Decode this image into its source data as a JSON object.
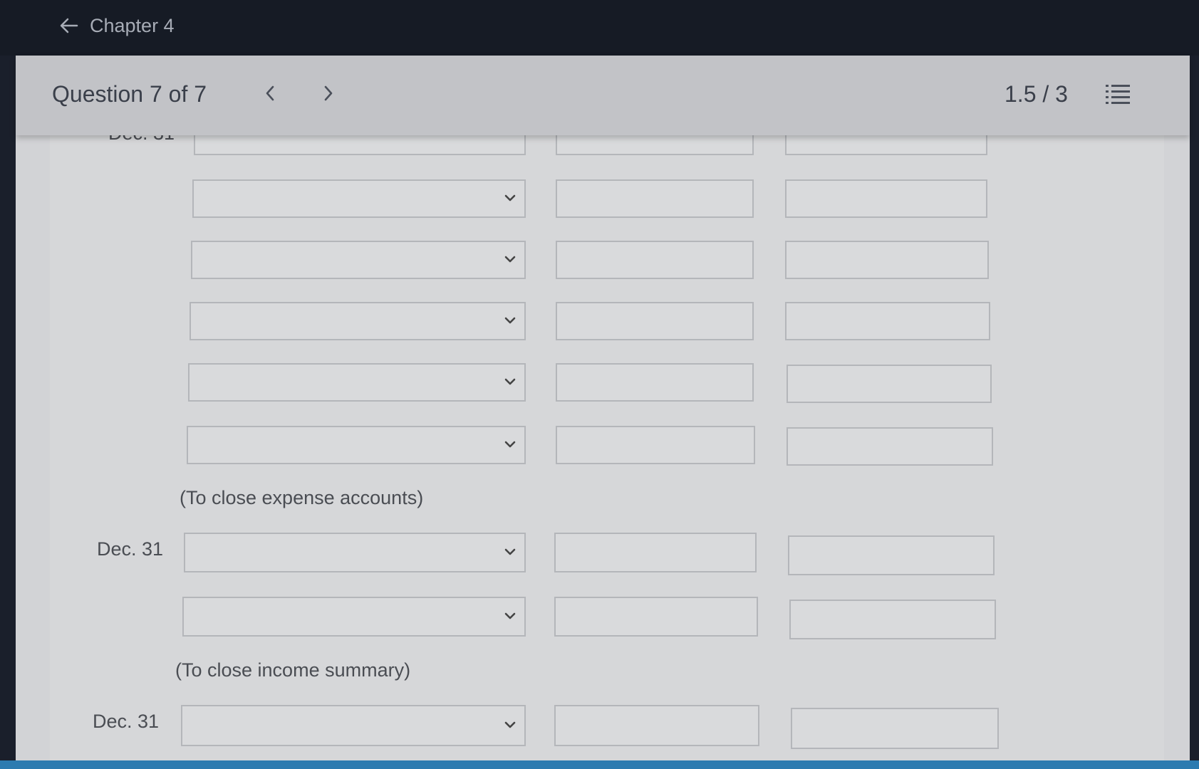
{
  "header": {
    "back_label": "Chapter 4"
  },
  "question_bar": {
    "title": "Question 7 of 7",
    "score": "1.5 / 3"
  },
  "entries": {
    "cut_off_date": "Dec. 31",
    "note_expense": "(To close expense accounts)",
    "date_income": "Dec. 31",
    "note_income": "(To close income summary)",
    "date_next": "Dec. 31"
  },
  "icons": {
    "back": "arrow-left-icon",
    "prev": "chevron-left-icon",
    "next": "chevron-right-icon",
    "list": "list-icon",
    "dropdown": "chevron-down-icon"
  }
}
